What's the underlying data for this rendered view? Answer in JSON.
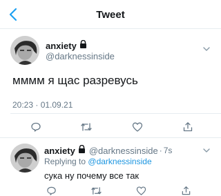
{
  "header": {
    "title": "Tweet"
  },
  "tweet": {
    "display_name": "anxiety",
    "handle": "@darknessinside",
    "text": "мммм я щас разревусь",
    "timestamp": "20:23 · 01.09.21"
  },
  "reply": {
    "display_name": "anxiety",
    "handle": "@darknessinside",
    "separator": "·",
    "time": "7s",
    "replying_prefix": "Replying to",
    "replying_handle": "@darknessinside",
    "text": "сука ну почему все так"
  },
  "icons": {
    "back": "chevron-left-icon",
    "lock": "lock-icon",
    "more": "chevron-down-icon",
    "reply": "reply-icon",
    "retweet": "retweet-icon",
    "like": "heart-icon",
    "share": "share-icon"
  },
  "colors": {
    "accent": "#1da1f2",
    "link": "#1b95e0",
    "secondary_text": "#657786",
    "divider": "#e6ecf0"
  }
}
